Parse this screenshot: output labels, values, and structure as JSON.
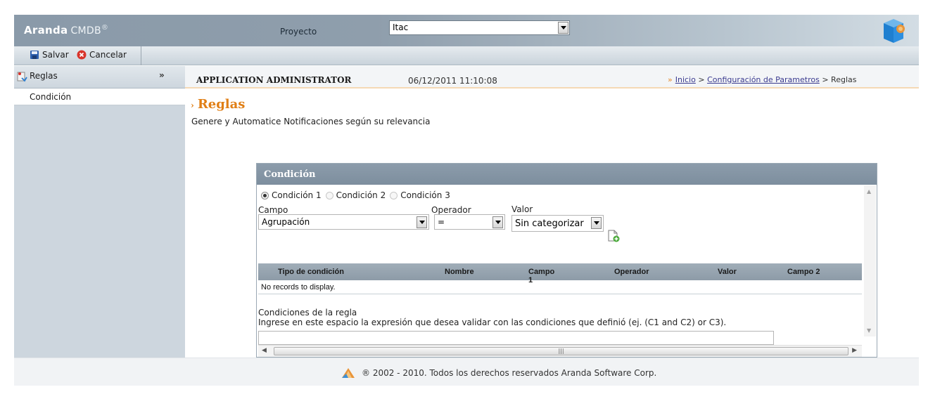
{
  "header": {
    "brand": "Aranda",
    "product": "CMDB",
    "reg": "®",
    "project_label": "Proyecto",
    "project_value": "Itac"
  },
  "toolbar": {
    "save_label": "Salvar",
    "cancel_label": "Cancelar"
  },
  "sidebar": {
    "section_label": "Reglas",
    "items": [
      {
        "label": "Condición"
      }
    ]
  },
  "infobar": {
    "user": "APPLICATION ADMINISTRATOR",
    "datetime": "06/12/2011 11:10:08",
    "breadcrumb": {
      "home": "Inicio",
      "sep1": ">",
      "parent": "Configuración de Parametros",
      "sep2": ">",
      "current": "Reglas"
    }
  },
  "page": {
    "title": "Reglas",
    "description": "Genere y Automatice Notificaciones según su relevancia"
  },
  "panel": {
    "title": "Condición",
    "radios": [
      {
        "label": "Condición 1",
        "selected": true
      },
      {
        "label": "Condición 2",
        "selected": false
      },
      {
        "label": "Condición 3",
        "selected": false
      }
    ],
    "campo_label": "Campo",
    "campo_value": "Agrupación",
    "operador_label": "Operador",
    "operador_value": "=",
    "valor_label": "Valor",
    "valor_value": "Sin categorizar",
    "grid": {
      "columns": [
        "Tipo de condición",
        "Nombre",
        "Campo 1",
        "Operador",
        "Valor",
        "Campo 2"
      ],
      "empty_text": "No records to display."
    },
    "rule_title": "Condiciones de la regla",
    "rule_help": "Ingrese en este espacio la expresión que desea validar con las condiciones que definió (ej. (C1 and C2) or C3).",
    "rule_value": ""
  },
  "footer": {
    "text": "® 2002 - 2010. Todos los derechos reservados Aranda Software Corp."
  },
  "colors": {
    "accent": "#e07f16",
    "header": "#8f9eac",
    "panel_header": "#8596a5"
  }
}
